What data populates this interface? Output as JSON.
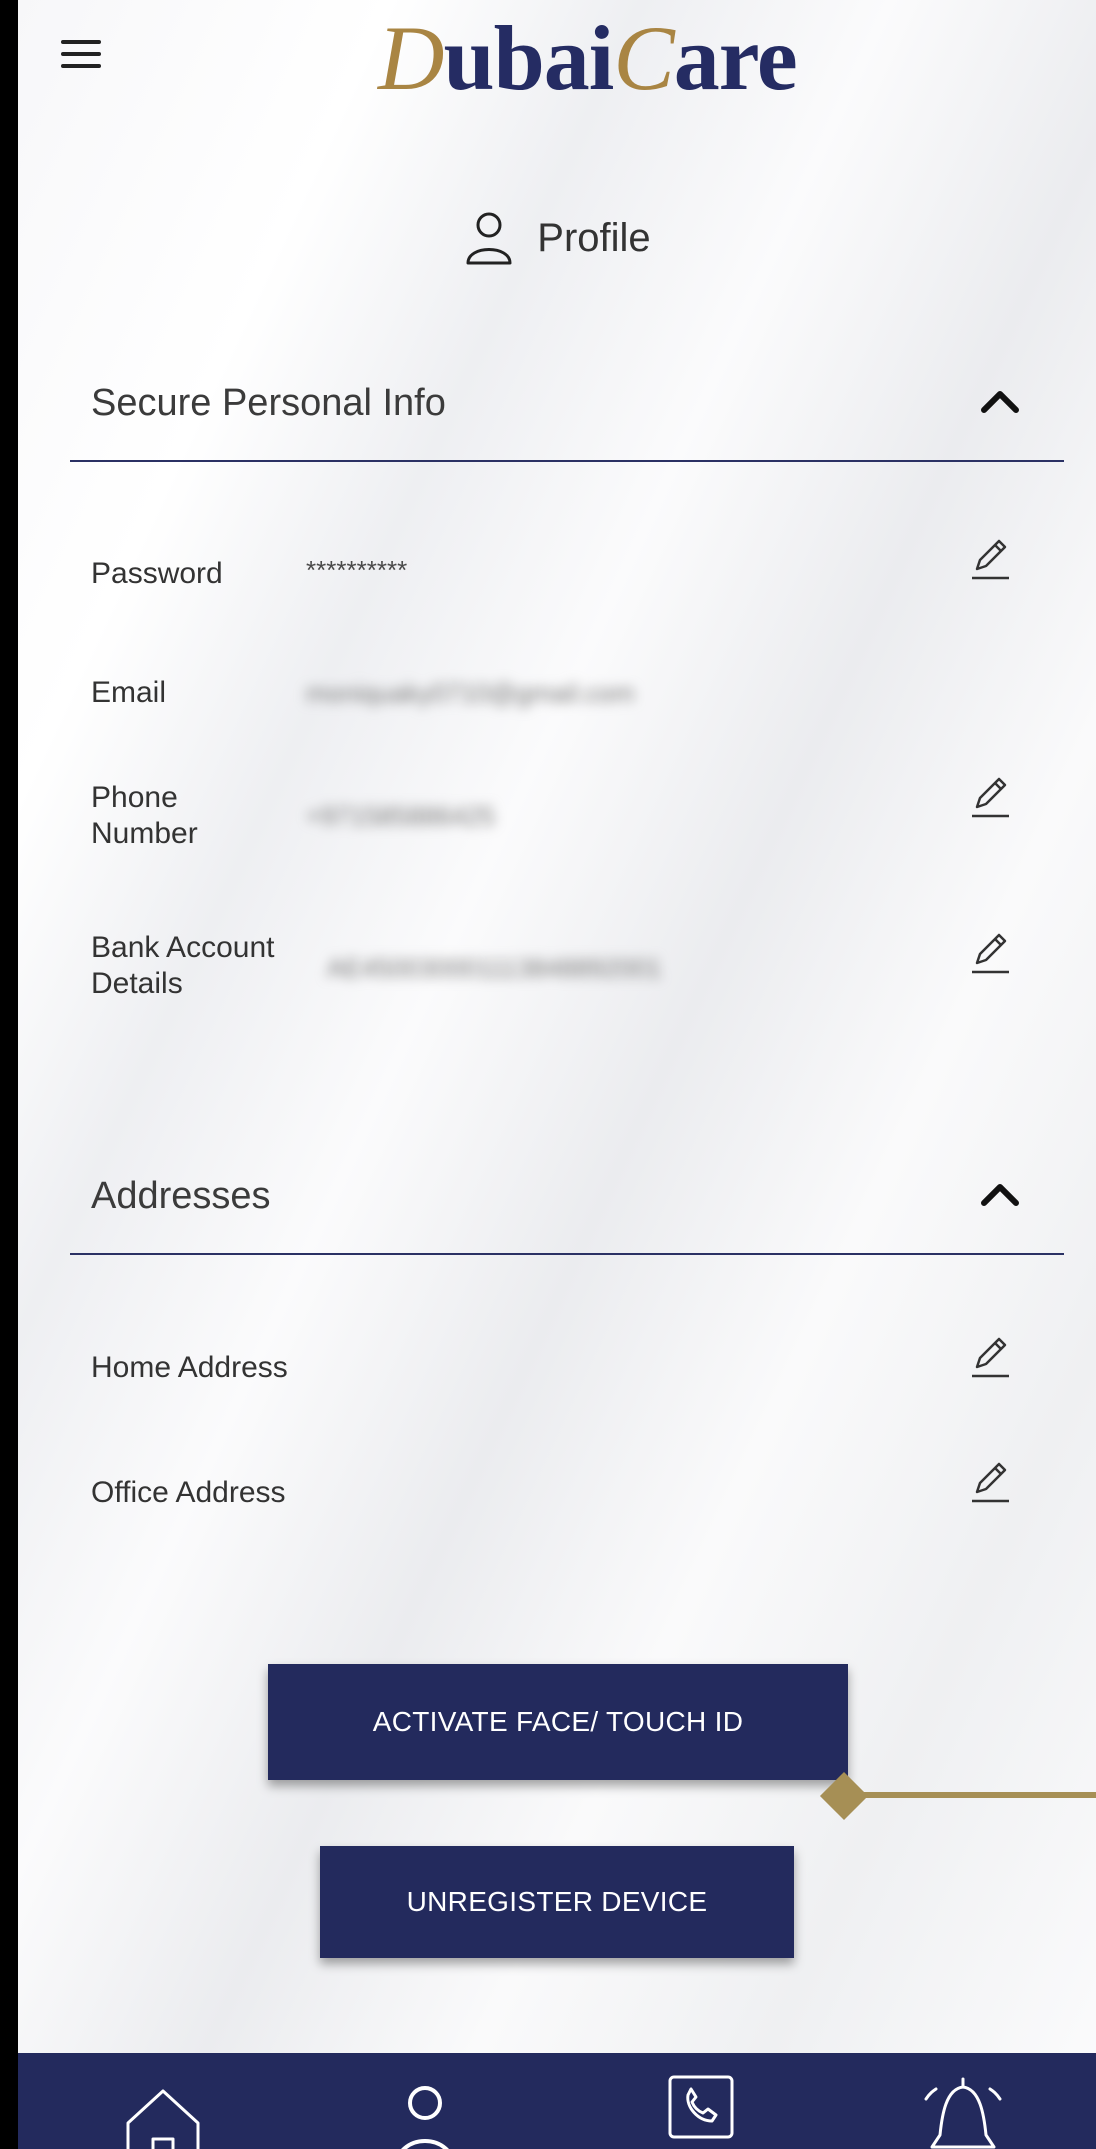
{
  "header": {
    "logo_part1": "D",
    "logo_part2": "ubai",
    "logo_part3": "C",
    "logo_part4": "are",
    "menu_icon": "hamburger-menu-icon"
  },
  "page": {
    "title": "Profile",
    "icon": "user-icon"
  },
  "secure_info": {
    "title": "Secure Personal Info",
    "rows": [
      {
        "label": "Password",
        "value": "**********",
        "editable": true
      },
      {
        "label": "Email",
        "value": "moniquaky0710@gmail.com",
        "editable": false
      },
      {
        "label": "Phone Number",
        "value": "+971585886425",
        "editable": true
      },
      {
        "label": "Bank Account Details",
        "value": "AE450030001113848892001",
        "editable": true
      }
    ]
  },
  "addresses": {
    "title": "Addresses",
    "rows": [
      {
        "label": "Home Address",
        "editable": true
      },
      {
        "label": "Office Address",
        "editable": true
      }
    ]
  },
  "buttons": {
    "activate": "ACTIVATE FACE/ TOUCH ID",
    "unregister": "UNREGISTER DEVICE"
  },
  "bottom_nav": [
    {
      "icon": "home-icon"
    },
    {
      "icon": "profile-icon"
    },
    {
      "icon": "phone-icon"
    },
    {
      "icon": "bell-icon"
    }
  ],
  "colors": {
    "navy": "#232a5d",
    "gold": "#a68f55"
  }
}
